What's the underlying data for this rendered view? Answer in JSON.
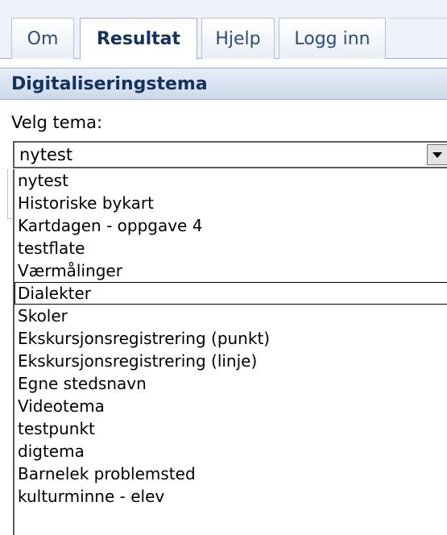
{
  "tabs": [
    {
      "label": "Om"
    },
    {
      "label": "Resultat"
    },
    {
      "label": "Hjelp"
    },
    {
      "label": "Logg inn"
    }
  ],
  "active_tab": "Resultat",
  "panel": {
    "title": "Digitaliseringstema",
    "select_label": "Velg tema:",
    "selected_value": "nytest",
    "hovered_option": "Dialekter"
  },
  "options": [
    "nytest",
    "Historiske bykart",
    "Kartdagen - oppgave 4",
    "testflate",
    "Værmålinger",
    "Dialekter",
    "Skoler",
    "Ekskursjonsregistrering (punkt)",
    "Ekskursjonsregistrering (linje)",
    "Egne stedsnavn",
    "Videotema",
    "testpunkt",
    "digtema",
    "Barnelek problemsted",
    "kulturminne - elev"
  ],
  "icons": {
    "dropdown_arrow": "triangle-down-icon"
  }
}
